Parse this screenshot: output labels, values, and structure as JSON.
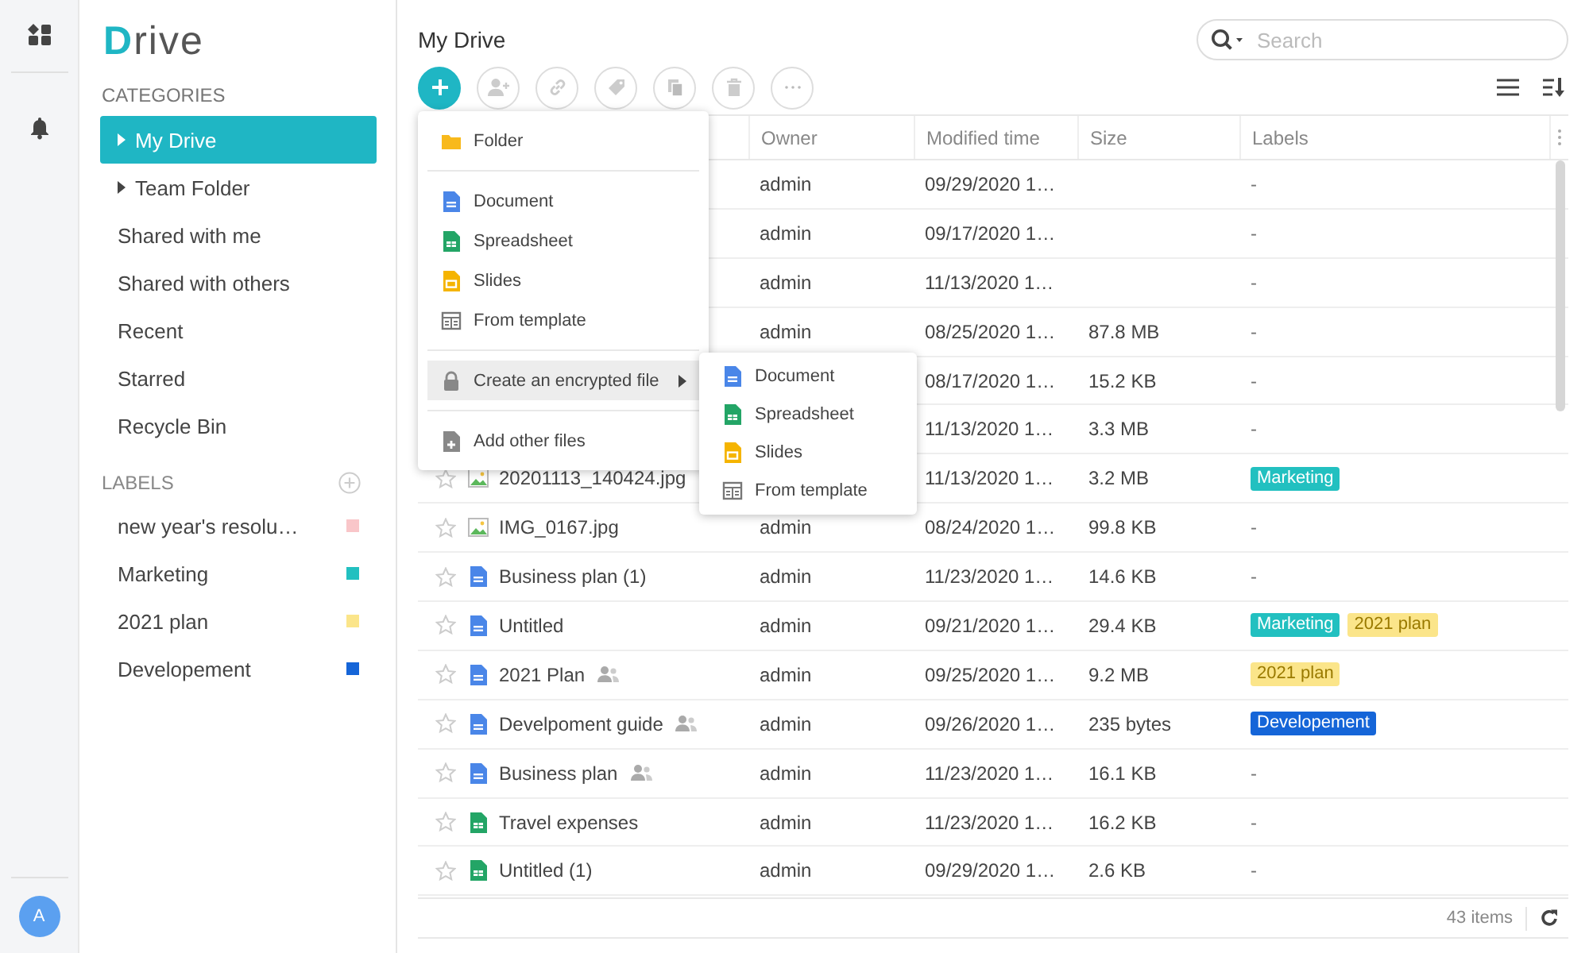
{
  "brand": {
    "logo": "Drive"
  },
  "categories": {
    "heading": "CATEGORIES",
    "items": [
      {
        "label": "My Drive",
        "expandable": true,
        "selected": true
      },
      {
        "label": "Team Folder",
        "expandable": true,
        "selected": false
      },
      {
        "label": "Shared with me",
        "expandable": false,
        "selected": false
      },
      {
        "label": "Shared with others",
        "expandable": false,
        "selected": false
      },
      {
        "label": "Recent",
        "expandable": false,
        "selected": false
      },
      {
        "label": "Starred",
        "expandable": false,
        "selected": false
      },
      {
        "label": "Recycle Bin",
        "expandable": false,
        "selected": false
      }
    ]
  },
  "labels": {
    "heading": "LABELS",
    "items": [
      {
        "label": "new year's resolu…",
        "color": "#f9c6c9"
      },
      {
        "label": "Marketing",
        "color": "#22c0c0"
      },
      {
        "label": "2021 plan",
        "color": "#fbe58a"
      },
      {
        "label": "Developement",
        "color": "#1565d8"
      }
    ]
  },
  "avatar": {
    "initial": "A"
  },
  "page": {
    "title": "My Drive"
  },
  "search": {
    "placeholder": "Search"
  },
  "table": {
    "columns": [
      "Owner",
      "Modified time",
      "Size",
      "Labels"
    ],
    "rows": [
      {
        "owner": "admin",
        "modified": "09/29/2020 1…",
        "empty_label": "-"
      },
      {
        "owner": "admin",
        "modified": "09/17/2020 1…",
        "empty_label": "-"
      },
      {
        "owner": "admin",
        "modified": "11/13/2020 1…",
        "empty_label": "-"
      },
      {
        "owner": "admin",
        "modified": "08/25/2020 1…",
        "size": "87.8 MB",
        "empty_label": "-"
      },
      {
        "modified": "08/17/2020 1…",
        "size": "15.2 KB",
        "empty_label": "-"
      },
      {
        "modified": "11/13/2020 1…",
        "size": "3.3 MB",
        "empty_label": "-"
      },
      {
        "name": "20201113_140424.jpg",
        "kind": "image",
        "starred": false,
        "shared": false,
        "modified": "11/13/2020 1…",
        "size": "3.2 MB",
        "labels": [
          {
            "text": "Marketing",
            "color": "#22c0c0"
          }
        ]
      },
      {
        "name": "IMG_0167.jpg",
        "kind": "image",
        "starred": false,
        "shared": false,
        "owner": "admin",
        "modified": "08/24/2020 1…",
        "size": "99.8 KB",
        "empty_label": "-"
      },
      {
        "name": "Business plan (1)",
        "kind": "document",
        "starred": false,
        "shared": false,
        "owner": "admin",
        "modified": "11/23/2020 1…",
        "size": "14.6 KB",
        "empty_label": "-"
      },
      {
        "name": "Untitled",
        "kind": "document",
        "starred": false,
        "shared": false,
        "owner": "admin",
        "modified": "09/21/2020 1…",
        "size": "29.4 KB",
        "labels": [
          {
            "text": "Marketing",
            "color": "#22c0c0"
          },
          {
            "text": "2021 plan",
            "color": "#fbe58a"
          }
        ]
      },
      {
        "name": "2021 Plan",
        "kind": "document",
        "starred": false,
        "shared": true,
        "owner": "admin",
        "modified": "09/25/2020 1…",
        "size": "9.2 MB",
        "labels": [
          {
            "text": "2021 plan",
            "color": "#fbe58a"
          }
        ]
      },
      {
        "name": "Develpoment guide",
        "kind": "document",
        "starred": false,
        "shared": true,
        "owner": "admin",
        "modified": "09/26/2020 1…",
        "size": "235 bytes",
        "labels": [
          {
            "text": "Developement",
            "color": "#1565d8"
          }
        ]
      },
      {
        "name": "Business plan",
        "kind": "document",
        "starred": false,
        "shared": true,
        "owner": "admin",
        "modified": "11/23/2020 1…",
        "size": "16.1 KB",
        "empty_label": "-"
      },
      {
        "name": "Travel expenses",
        "kind": "spreadsheet",
        "starred": false,
        "shared": false,
        "owner": "admin",
        "modified": "11/23/2020 1…",
        "size": "16.2 KB",
        "empty_label": "-"
      },
      {
        "name": "Untitled (1)",
        "kind": "spreadsheet",
        "starred": false,
        "shared": false,
        "owner": "admin",
        "modified": "09/29/2020 1…",
        "size": "2.6 KB",
        "empty_label": "-"
      }
    ],
    "footer": {
      "count": "43 items"
    }
  },
  "new_menu": {
    "groups": [
      [
        {
          "label": "Folder",
          "kind": "folder",
          "selected": false
        }
      ],
      [
        {
          "label": "Document",
          "kind": "document",
          "selected": false
        },
        {
          "label": "Spreadsheet",
          "kind": "spreadsheet",
          "selected": false
        },
        {
          "label": "Slides",
          "kind": "slides",
          "selected": false
        },
        {
          "label": "From template",
          "kind": "template",
          "selected": false
        }
      ],
      [
        {
          "label": "Create an encrypted file",
          "kind": "lock",
          "selected": true,
          "has_submenu": true
        }
      ],
      [
        {
          "label": "Add other files",
          "kind": "add",
          "selected": false
        }
      ]
    ]
  },
  "submenu": {
    "items": [
      {
        "label": "Document",
        "kind": "document"
      },
      {
        "label": "Spreadsheet",
        "kind": "spreadsheet"
      },
      {
        "label": "Slides",
        "kind": "slides"
      },
      {
        "label": "From template",
        "kind": "template"
      }
    ]
  }
}
